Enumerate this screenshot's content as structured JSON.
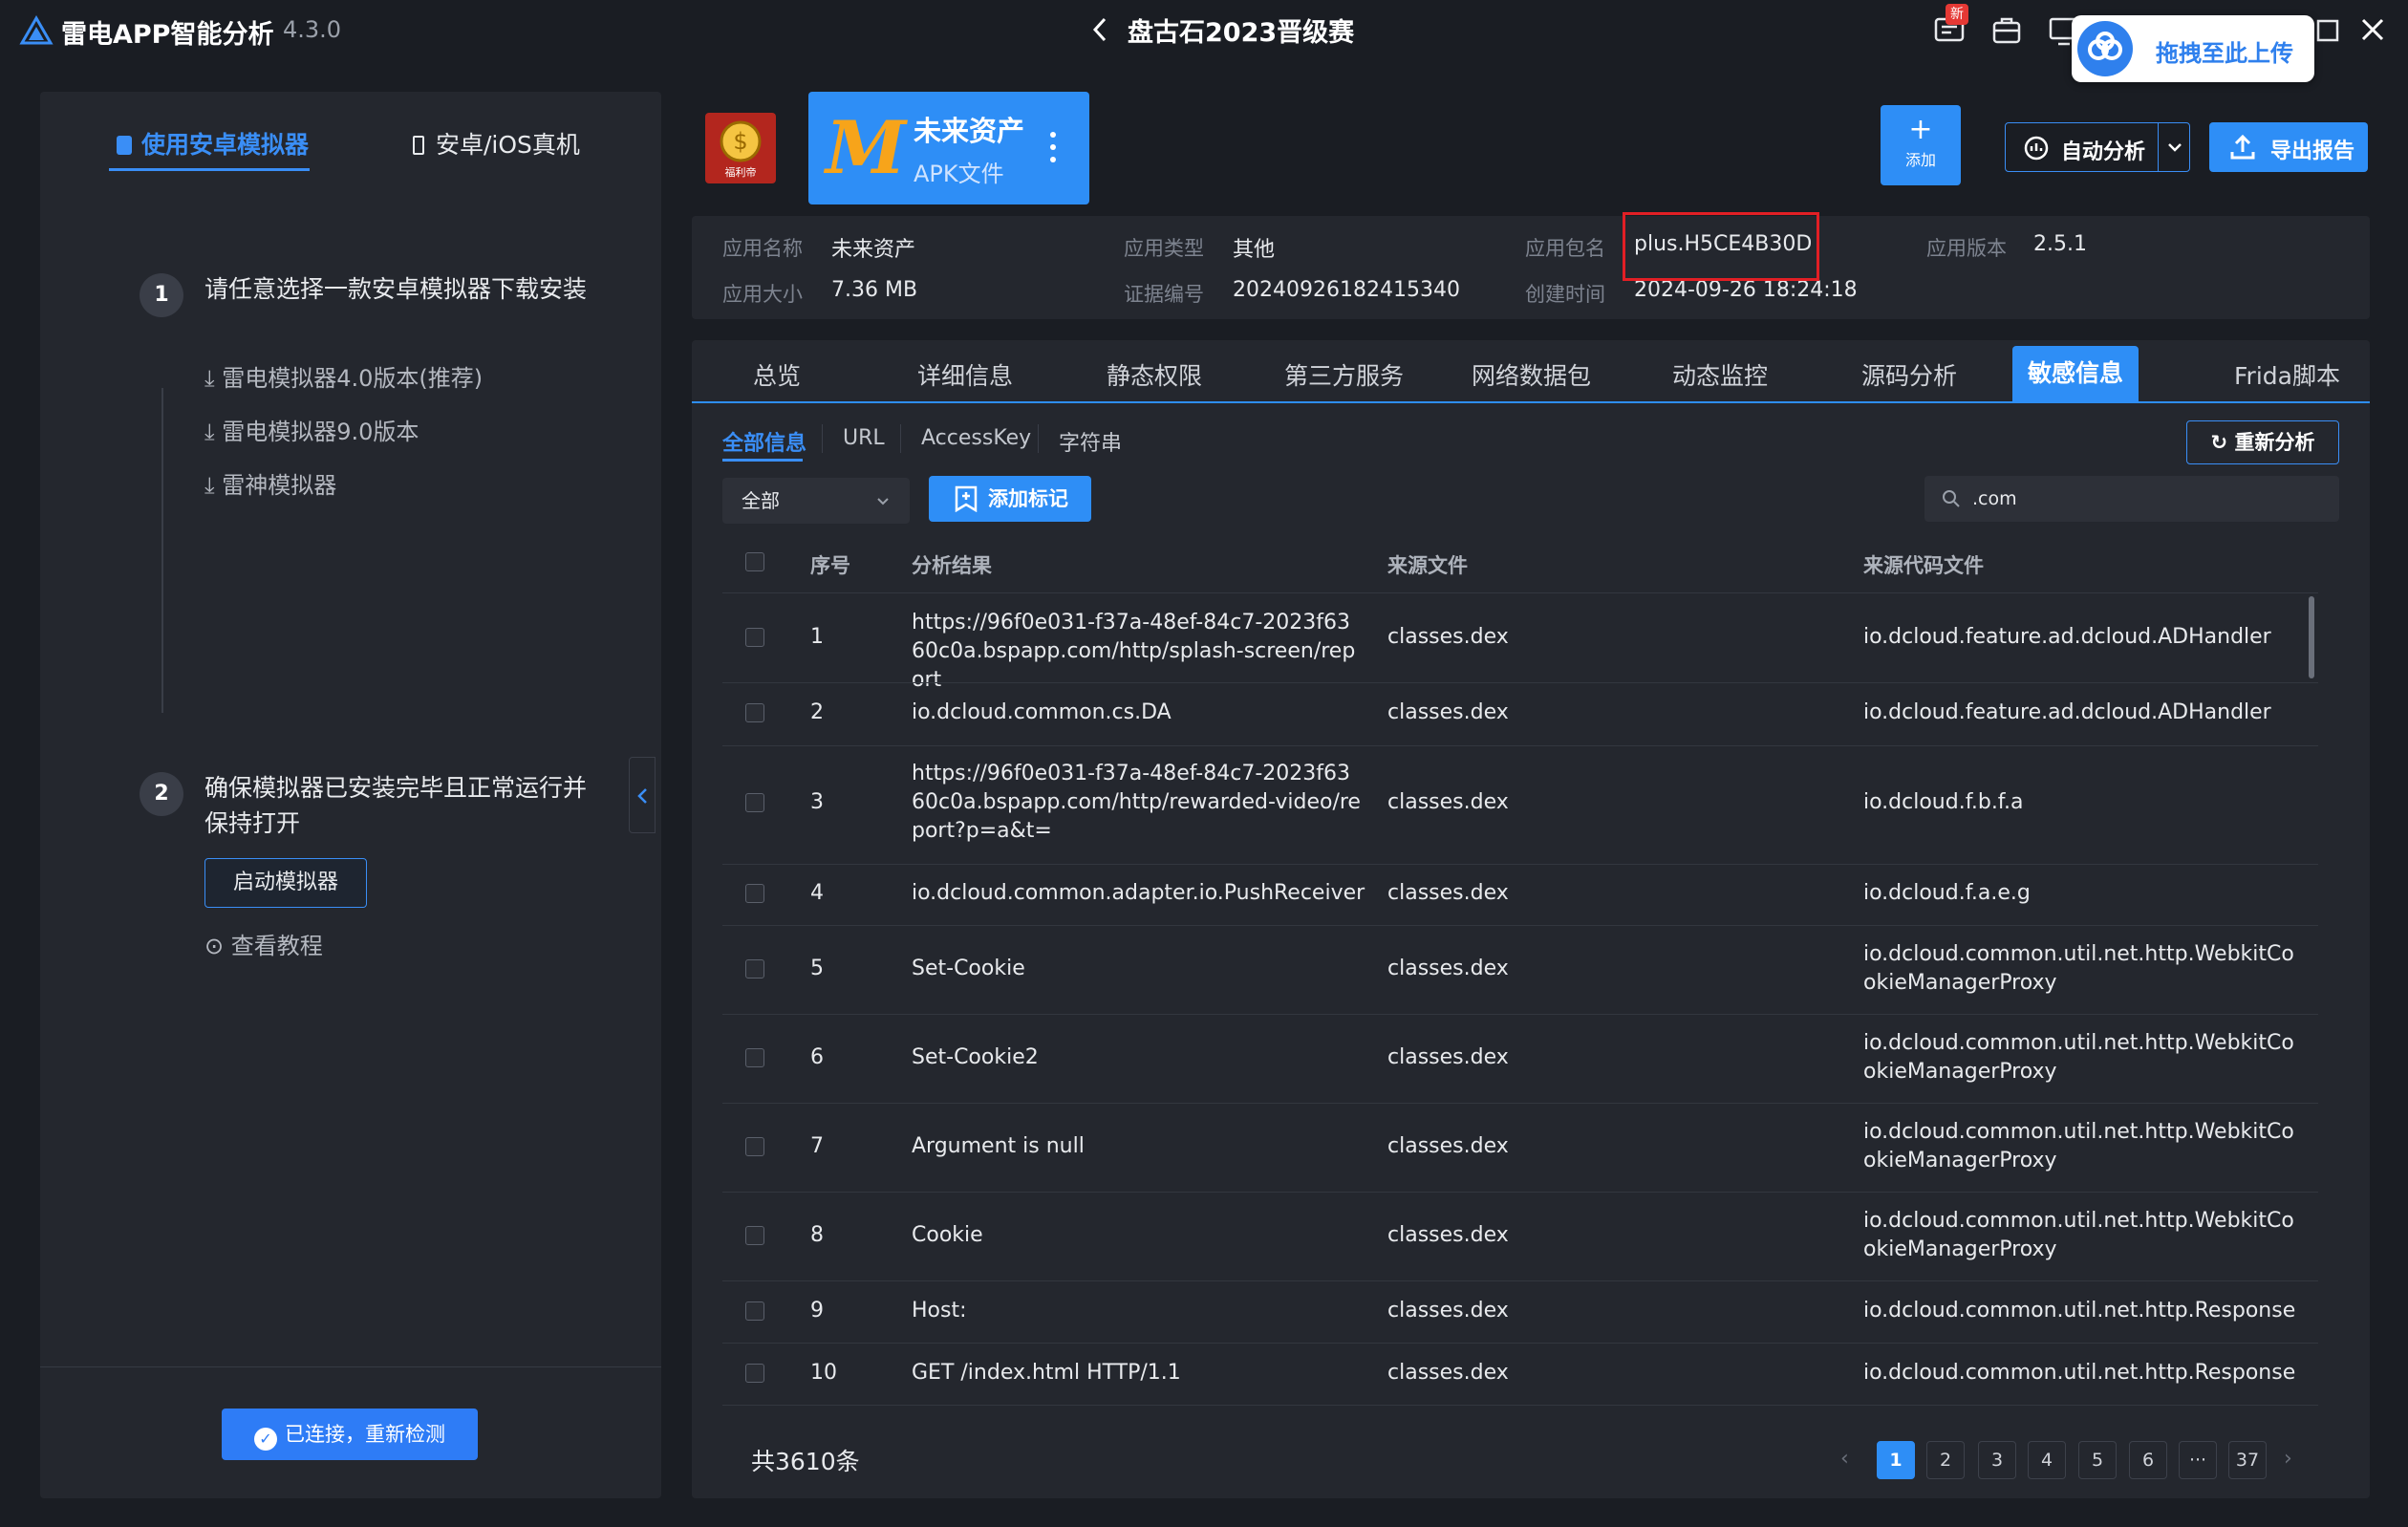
{
  "titlebar": {
    "app_name": "雷电APP智能分析",
    "version": "4.3.0",
    "project_title": "盘古石2023晋级赛",
    "new_badge": "新",
    "upload_text": "拖拽至此上传"
  },
  "left_panel": {
    "tab_emulator": "使用安卓模拟器",
    "tab_device": "安卓/iOS真机",
    "step1_num": "1",
    "step1_text": "请任意选择一款安卓模拟器下载安装",
    "downloads": [
      "雷电模拟器4.0版本(推荐)",
      "雷电模拟器9.0版本",
      "雷神模拟器"
    ],
    "step2_num": "2",
    "step2_text": "确保模拟器已安装完毕且正常运行并保持打开",
    "start_button": "启动模拟器",
    "tutorial": "查看教程",
    "connected_button": "已连接，重新检测"
  },
  "app_card": {
    "name": "未来资产",
    "type": "APK文件",
    "icon_letter": "M",
    "icon_caption": "福利帝"
  },
  "toolbar": {
    "add_label": "添加",
    "auto_label": "自动分析",
    "export_label": "导出报告"
  },
  "info": {
    "name_k": "应用名称",
    "name_v": "未来资产",
    "type_k": "应用类型",
    "type_v": "其他",
    "pkg_k": "应用包名",
    "pkg_v": "plus.H5CE4B30D",
    "ver_k": "应用版本",
    "ver_v": "2.5.1",
    "size_k": "应用大小",
    "size_v": "7.36 MB",
    "cert_k": "证据编号",
    "cert_v": "20240926182415340",
    "time_k": "创建时间",
    "time_v": "2024-09-26 18:24:18"
  },
  "tabs": [
    "总览",
    "详细信息",
    "静态权限",
    "第三方服务",
    "网络数据包",
    "动态监控",
    "源码分析",
    "敏感信息",
    "Frida脚本"
  ],
  "subtabs": [
    "全部信息",
    "URL",
    "AccessKey",
    "字符串"
  ],
  "filter": {
    "select_value": "全部",
    "mark_button": "添加标记",
    "search_value": ".com",
    "reanalyze_button": "重新分析"
  },
  "table": {
    "headers": [
      "序号",
      "分析结果",
      "来源文件",
      "来源代码文件"
    ],
    "rows": [
      {
        "no": "1",
        "result": "https://96f0e031-f37a-48ef-84c7-2023f6360c0a.bspapp.com/http/splash-screen/report",
        "file": "classes.dex",
        "code": "io.dcloud.feature.ad.dcloud.ADHandler"
      },
      {
        "no": "2",
        "result": "io.dcloud.common.cs.DA",
        "file": "classes.dex",
        "code": "io.dcloud.feature.ad.dcloud.ADHandler"
      },
      {
        "no": "3",
        "result": "https://96f0e031-f37a-48ef-84c7-2023f6360c0a.bspapp.com/http/rewarded-video/report?p=a&t=",
        "file": "classes.dex",
        "code": "io.dcloud.f.b.f.a"
      },
      {
        "no": "4",
        "result": "io.dcloud.common.adapter.io.PushReceiver",
        "file": "classes.dex",
        "code": "io.dcloud.f.a.e.g"
      },
      {
        "no": "5",
        "result": "Set-Cookie",
        "file": "classes.dex",
        "code": "io.dcloud.common.util.net.http.WebkitCookieManagerProxy"
      },
      {
        "no": "6",
        "result": "Set-Cookie2",
        "file": "classes.dex",
        "code": "io.dcloud.common.util.net.http.WebkitCookieManagerProxy"
      },
      {
        "no": "7",
        "result": "Argument is null",
        "file": "classes.dex",
        "code": "io.dcloud.common.util.net.http.WebkitCookieManagerProxy"
      },
      {
        "no": "8",
        "result": "Cookie",
        "file": "classes.dex",
        "code": "io.dcloud.common.util.net.http.WebkitCookieManagerProxy"
      },
      {
        "no": "9",
        "result": "Host:",
        "file": "classes.dex",
        "code": "io.dcloud.common.util.net.http.Response"
      },
      {
        "no": "10",
        "result": "GET /index.html HTTP/1.1",
        "file": "classes.dex",
        "code": "io.dcloud.common.util.net.http.Response"
      }
    ]
  },
  "pagination": {
    "total": "共3610条",
    "pages": [
      "1",
      "2",
      "3",
      "4",
      "5",
      "6",
      "···",
      "37"
    ],
    "current": "1"
  },
  "colors": {
    "accent": "#2e8ef6",
    "highlight": "#e21f25",
    "background": "#1a1d23",
    "panel": "#24272e"
  }
}
